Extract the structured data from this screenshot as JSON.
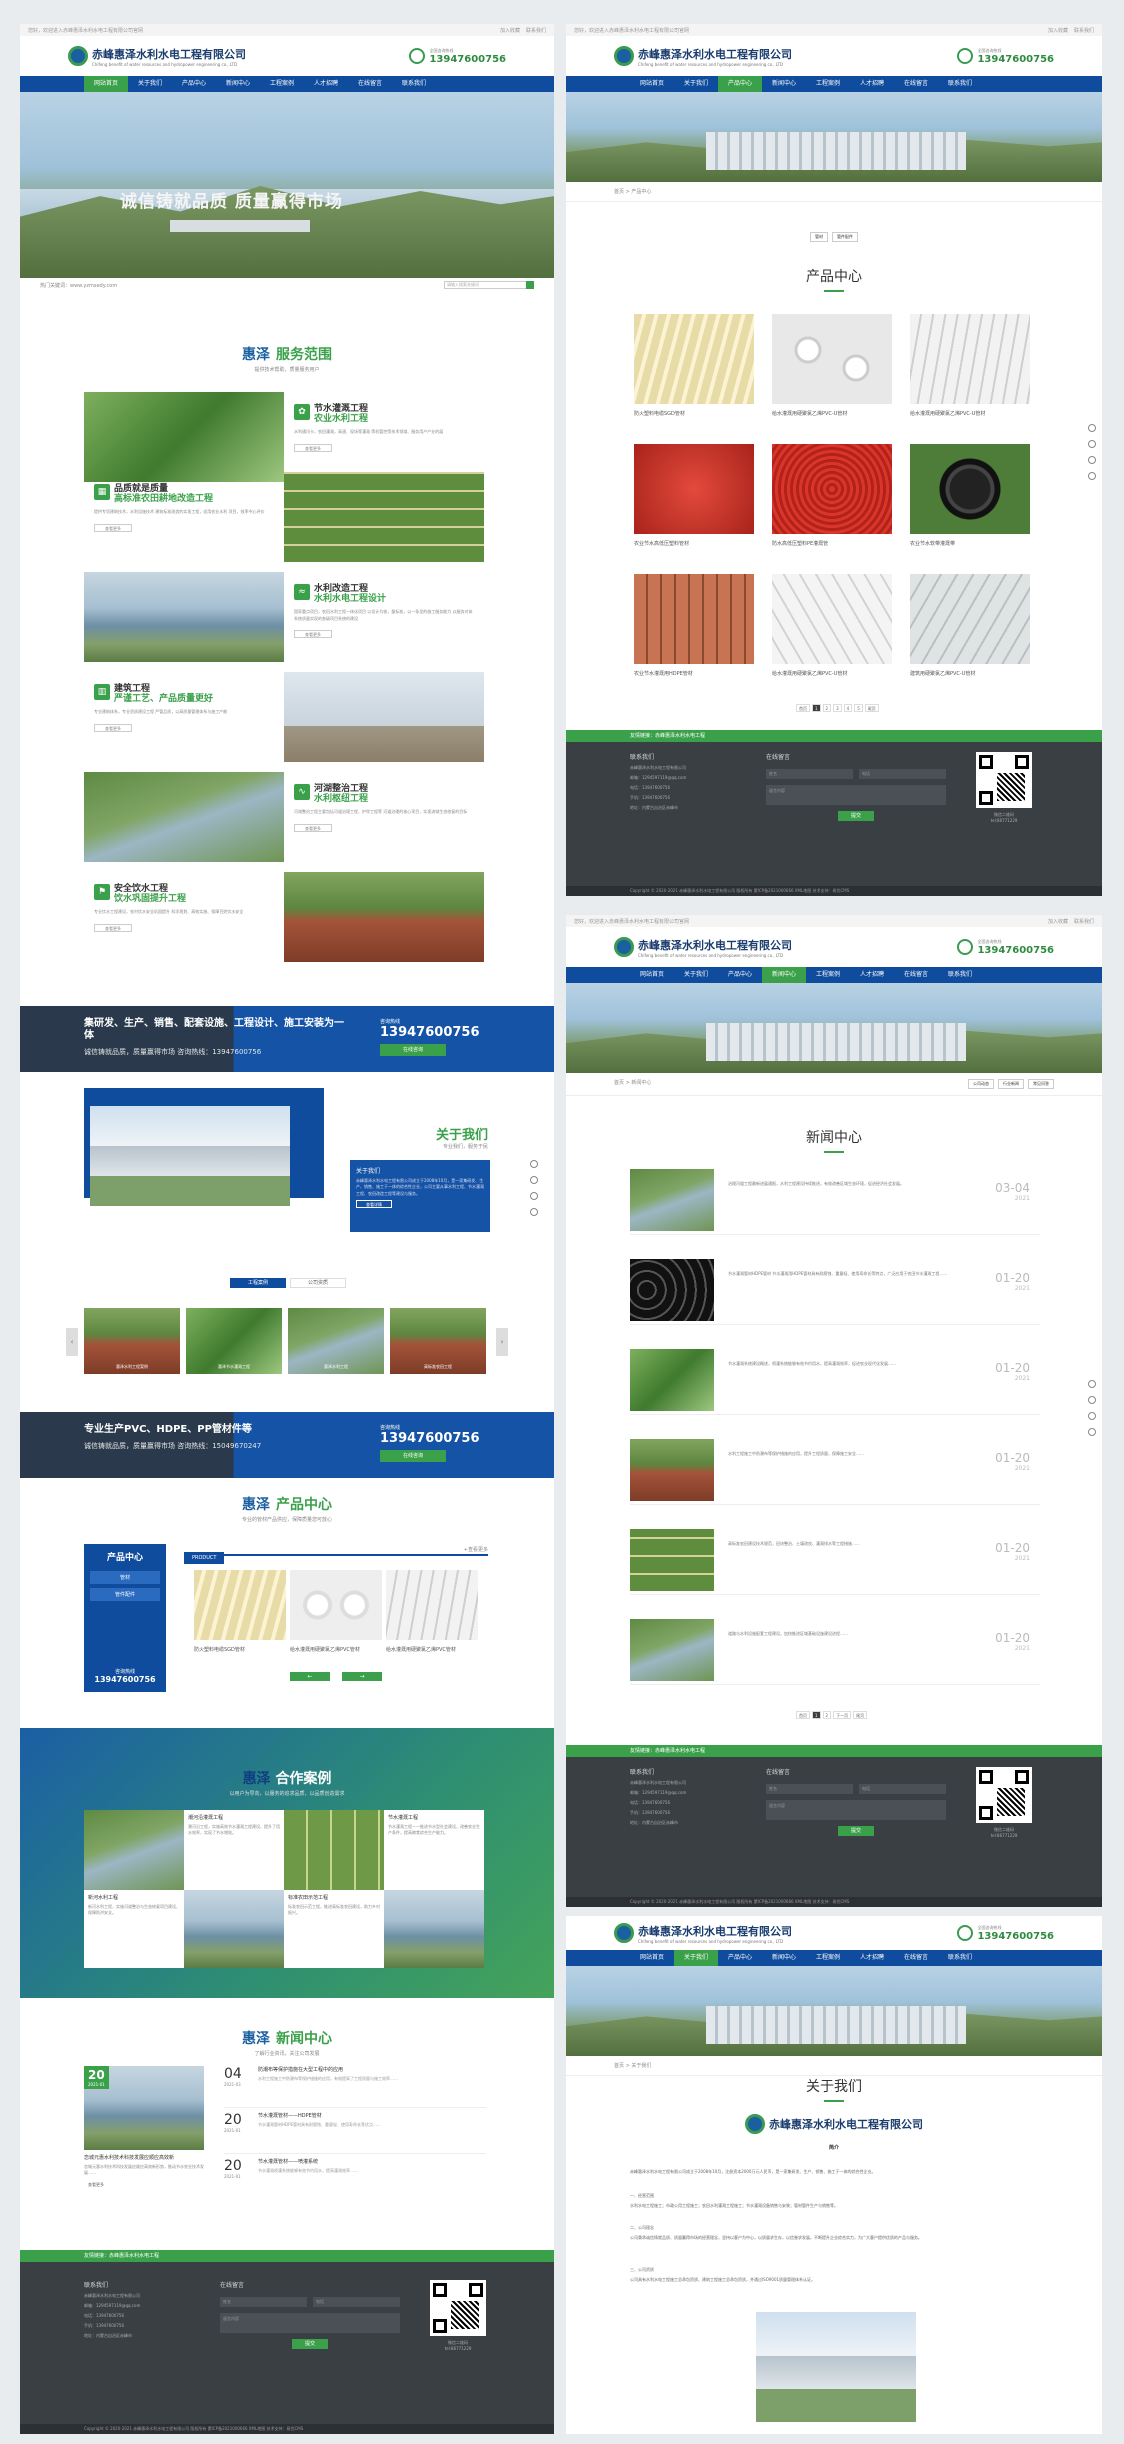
{
  "site": {
    "top_left": "您好，欢迎进入赤峰惠泽水利水电工程有限公司官网",
    "top_links": [
      "加入收藏",
      "联系我们"
    ],
    "logo_cn": "赤峰惠泽水利水电工程有限公司",
    "logo_en": "Chifeng benefit of water resources and hydropower engineering co., LTD",
    "hotline_label": "全国咨询热线",
    "hotline": "13947600756",
    "nav": [
      "网站首页",
      "关于我们",
      "产品中心",
      "新闻中心",
      "工程案例",
      "人才招聘",
      "在线留言",
      "联系我们"
    ]
  },
  "home": {
    "slogan": "诚信铸就品质  质量赢得市场",
    "hot_search": "热门关键词：www.yzmsedy.com",
    "search_placeholder": "请输入搜索关键词",
    "services": {
      "title": "惠泽",
      "title2": "服务范围",
      "sub": "提供技术帮助，质量服务用户",
      "items": [
        {
          "t1": "节水灌溉工程",
          "t2": "农业水利工程",
          "desc": "水利通讯卡，农田灌溉，高速、现场等灌溉 等机管控等技术领域、服务用户产业的展",
          "more": "查看更多"
        },
        {
          "t1": "品质就是质量",
          "t2": "高标准农田耕地改造工程",
          "desc": "提供专项建筑技术，水利设施技术 建筑标准改造的实现工程，适用农业水利 项目，效率中心评价",
          "more": "查看更多"
        },
        {
          "t1": "水利改造工程",
          "t2": "水利水电工程设计",
          "desc": "国家重点项目，农田水利工程一体化项目 以设计为核，量标准，以一条龙的施工服务能力 以服务对体系统质量实现的各级项目系统的建设",
          "more": "查看更多"
        },
        {
          "t1": "建筑工程",
          "t2": "严谨工艺、产品质量更好",
          "desc": "专业建筑体系，专业资质建设工程 严管品质，以高质量管理体系与施工产能",
          "more": "查看更多"
        },
        {
          "t1": "河湖整治工程",
          "t2": "水利枢纽工程",
          "desc": "河湖整治工程主要包括河道治理工程、护岸工程等 河道治理的核心项目，实现流域生态修复的目标",
          "more": "查看更多"
        },
        {
          "t1": "安全饮水工程",
          "t2": "饮水巩固提升工程",
          "desc": "专业饮水工程建设，农村饮水安全巩固提升 科学规划、高效实施、保障百姓饮水安全",
          "more": "查看更多"
        }
      ]
    },
    "strip1": {
      "t": "集研发、生产、销售、配套设施、工程设计、施工安装为一体",
      "sub": "诚信铸就品质，质量赢得市场  咨询热线：13947600756",
      "hot_label": "咨询热线",
      "btn": "在线咨询"
    },
    "about": {
      "title": "关于我们",
      "sub": "专业我们，服务于民",
      "head": "关于我们",
      "body": "赤峰惠泽水利水电工程有限公司成立于2008年10月，是一家集研发、生产、销售、施工于一体的综合性企业，公司主要从事水利工程、节水灌溉工程、农田改造工程等建设与服务。",
      "more": "查看详情",
      "tabs": [
        "工程案例",
        "公司资质"
      ],
      "thumbs": [
        "惠泽水利工程案例",
        "惠泽节水灌溉工程",
        "惠泽水利工程",
        "高标准农田工程"
      ]
    },
    "strip2": {
      "t": "专业生产PVC、HDPE、PP管材件等",
      "sub": "诚信铸就品质，质量赢得市场  咨询热线：15049670247",
      "hot_label": "咨询热线",
      "hot": "13947600756",
      "btn": "在线咨询"
    },
    "products": {
      "title": "惠泽",
      "title2": "产品中心",
      "sub": "专业的管材产品供应，保障质量您可放心",
      "side_title": "产品中心",
      "side_items": [
        "管材",
        "管件配件"
      ],
      "side_hot_label": "咨询热线",
      "side_hot": "13947600756",
      "tab": "PRODUCT",
      "more": "+查看更多",
      "items": [
        "防火塑料电缆SGD管材",
        "给水灌溉用硬聚氯乙烯PVC管材",
        "给水灌溉用硬聚氯乙烯PVC管材"
      ],
      "arrows": [
        "←",
        "→"
      ]
    },
    "cases": {
      "title": "惠泽",
      "title2": "合作案例",
      "sub": "以用户为导向，以服务的追求品质，以品质创造需求",
      "items": [
        {
          "t": "潮河沿灌溉工程",
          "d": "潮河沿工程，实施高效节水灌溉工程建设，提升了用水效率，实现了节水增效。"
        },
        {
          "t": "节水灌溉工程",
          "d": "节水灌溉工程——推进节水型社会建设，改善农业生产条件，提高粮食综合生产能力。"
        },
        {
          "t": "新河水利工程",
          "d": "新河水利工程，实施河道整治与生态修复项目建设，保障防洪安全。"
        },
        {
          "t": "标准农田示范工程",
          "d": "标准农田示范工程，推进高标准农田建设，助力乡村振兴。"
        }
      ]
    },
    "news": {
      "title": "惠泽",
      "title2": "新闻中心",
      "sub": "了解行业资讯，关注公司发展",
      "feature": {
        "day": "20",
        "ym": "2021-01",
        "t": "恋城元惠水利技术科技发展应顺应高效新",
        "d": "恋城元惠水利技术科技发展应顺应高效新形势，推动节水农业技术发展……"
      },
      "items": [
        {
          "day": "04",
          "ym": "2021-03",
          "t": "防潮布等保护措施在大型工程中的应用",
          "d": "水利工程施工中防潮布等保护措施的应用，有效提高了工程质量与施工效率……"
        },
        {
          "day": "20",
          "ym": "2021-01",
          "t": "节水灌溉管材——HDPE管材",
          "d": "节水灌溉管材HDPE管材具有耐腐蚀、重量轻、使用寿命长等优点……"
        },
        {
          "day": "20",
          "ym": "2021-01",
          "t": "节水灌溉管材——喷灌系统",
          "d": "节水灌溉喷灌系统能够有效节约用水，提高灌溉效率……"
        }
      ],
      "more": "查看更多"
    },
    "footer": {
      "bar": "友情链接：赤峰惠泽水利水电工程",
      "contact_h": "联系我们",
      "lines": [
        "赤峰惠泽水利水电工程有限公司",
        "邮箱：1294597119@qq.com",
        "电话：13947600756",
        "手机：13947600756",
        "地址：内蒙古自治区赤峰市"
      ],
      "msg_h": "在线留言",
      "fields": [
        "姓名",
        "电话",
        "留言内容"
      ],
      "submit": "提交",
      "qr_label": "微信二维码",
      "qr_phone": "tel:86771229",
      "copyright": "Copyright © 2020-2021 赤峰惠泽水利水电工程有限公司 版权所有  蒙ICP备2021000666  XML地图  技术支持：易优CMS"
    }
  },
  "products_page": {
    "crumb": "首页 > 产品中心",
    "tags": [
      "管材",
      "管件配件"
    ],
    "title": "产品中心",
    "items": [
      "防火塑料电缆SGD管材",
      "给水灌溉用硬聚氯乙烯PVC-U管材",
      "给水灌溉用硬聚氯乙烯PVC-U管材",
      "农业节水高低压塑料管材",
      "防水高低压塑料PE灌溉管",
      "农业节水软带灌溉带",
      "农业节水灌溉用HDPE管材",
      "给水灌溉用硬聚氯乙烯PVC-U管材",
      "建筑用硬聚氯乙烯PVC-U管材"
    ],
    "pager": [
      "首页",
      "1",
      "2",
      "3",
      "4",
      "5",
      "尾页"
    ]
  },
  "news_page": {
    "crumb": "首页 > 新闻中心",
    "tags": [
      "公司动态",
      "行业新闻",
      "常见问答"
    ],
    "title": "新闻中心",
    "items": [
      {
        "d": "治理河道工程最新进展通报，水利工程建设持续推进，有效改善区域生态环境，促进经济社会发展。",
        "day": "03-04",
        "y": "2021"
      },
      {
        "d": "节水灌溉管材HDPE管材 节水灌溉用HDPE管材具有耐腐蚀、重量轻、使用寿命长等特点，广泛应用于农田节水灌溉工程……",
        "day": "01-20",
        "y": "2021"
      },
      {
        "d": "节水灌溉系统建设概述，喷灌系统能够有效节约用水，提高灌溉效率，促进农业现代化发展……",
        "day": "01-20",
        "y": "2021"
      },
      {
        "d": "水利工程施工中防潮布等保护措施的应用，提升工程质量，保障施工安全……",
        "day": "01-20",
        "y": "2021"
      },
      {
        "d": "高标准农田建设技术规范，田块整治、土壤改良、灌溉排水等工程措施……",
        "day": "01-20",
        "y": "2021"
      },
      {
        "d": "道路与水利设施配套工程建设，加快推进区域基础设施建设进程……",
        "day": "01-20",
        "y": "2021"
      }
    ],
    "pager": [
      "首页",
      "1",
      "2",
      "下一页",
      "尾页"
    ]
  },
  "about_page": {
    "crumb": "首页 > 关于我们",
    "title": "关于我们",
    "intro_h": "简介",
    "paras": [
      "赤峰惠泽水利水电工程有限公司成立于2008年10月，注册资本2000万元人民币，是一家集研发、生产、销售、施工于一体的综合性企业。",
      "一、经营范围",
      "水利水电工程施工；市政公用工程施工；农田水利灌溉工程施工；节水灌溉设备销售与安装；管材管件生产与销售等。",
      "二、公司理念",
      "公司秉承诚信铸就品质、质量赢得市场的经营理念，坚持以客户为中心，以质量求生存，以信誉求发展，不断提升企业综合实力，为广大客户提供优质的产品与服务。",
      "三、公司资质",
      "公司具有水利水电工程施工总承包资质、建筑工程施工总承包资质，并通过ISO9001质量管理体系认证。"
    ]
  }
}
